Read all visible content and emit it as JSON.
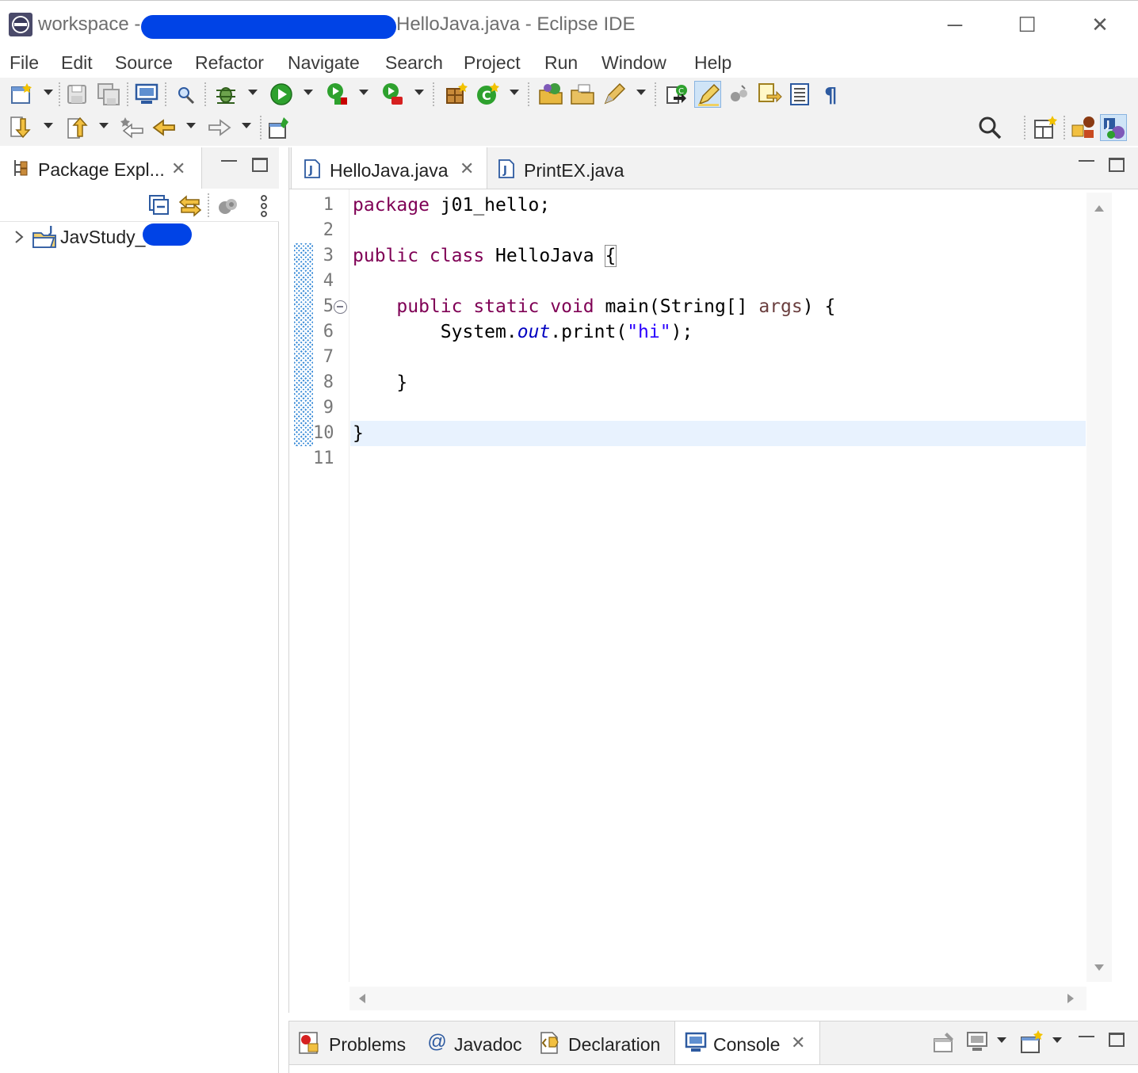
{
  "window": {
    "title_prefix": "workspace -",
    "title_suffix": "HelloJava.java - Eclipse IDE",
    "minimize": "─",
    "maximize": "☐",
    "close": "✕"
  },
  "menu": [
    "File",
    "Edit",
    "Source",
    "Refactor",
    "Navigate",
    "Search",
    "Project",
    "Run",
    "Window",
    "Help"
  ],
  "package_explorer": {
    "tab_label": "Package Expl...",
    "close": "✕",
    "project": "JavStudy_"
  },
  "editor": {
    "tabs": [
      {
        "label": "HelloJava.java",
        "close": "✕"
      },
      {
        "label": "PrintEX.java"
      }
    ],
    "line_numbers": [
      "1",
      "2",
      "3",
      "4",
      "5",
      "6",
      "7",
      "8",
      "9",
      "10",
      "11"
    ],
    "code": {
      "l1_kw": "package",
      "l1_rest": " j01_hello;",
      "l3_kw": "public class",
      "l3_rest": " HelloJava ",
      "l3_brace": "{",
      "l5_indent": "    ",
      "l5_kw": "public static void",
      "l5_mid": " main(String[] ",
      "l5_param": "args",
      "l5_end": ") {",
      "l6_indent": "        System.",
      "l6_field": "out",
      "l6_mid": ".print(",
      "l6_str": "\"hi\"",
      "l6_end": ");",
      "l8": "    }",
      "l10": "}"
    }
  },
  "bottom_panel": {
    "tabs": [
      {
        "label": "Problems"
      },
      {
        "label": "Javadoc",
        "icon_glyph": "@"
      },
      {
        "label": "Declaration"
      },
      {
        "label": "Console",
        "close": "✕"
      }
    ]
  },
  "colors": {
    "keyword": "#7f0055",
    "string": "#2a00ff",
    "field": "#0000c0",
    "current_line": "#e8f2fe",
    "redaction": "#0043e6"
  }
}
